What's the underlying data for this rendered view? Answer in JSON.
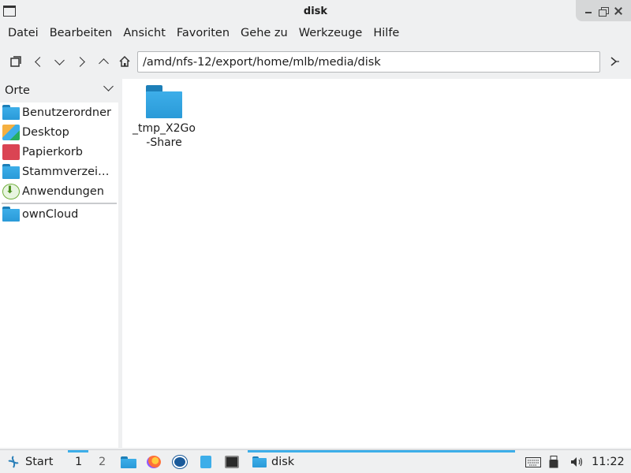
{
  "window": {
    "title": "disk"
  },
  "menubar": [
    "Datei",
    "Bearbeiten",
    "Ansicht",
    "Favoriten",
    "Gehe zu",
    "Werkzeuge",
    "Hilfe"
  ],
  "toolbar": {
    "path": "/amd/nfs-12/export/home/mlb/media/disk"
  },
  "sidepane": {
    "header": "Orte",
    "places": [
      {
        "label": "Benutzerordner",
        "icon": "home-folder-icon"
      },
      {
        "label": "Desktop",
        "icon": "desktop-icon"
      },
      {
        "label": "Papierkorb",
        "icon": "trash-icon"
      },
      {
        "label": "Stammverzei…",
        "icon": "root-folder-icon"
      },
      {
        "label": "Anwendungen",
        "icon": "applications-icon"
      }
    ],
    "bookmarks": [
      {
        "label": "ownCloud",
        "icon": "folder-icon"
      }
    ]
  },
  "files": [
    {
      "name_line1": "_tmp_X2Go",
      "name_line2": "-Share",
      "icon": "folder-icon"
    }
  ],
  "taskbar": {
    "start_label": "Start",
    "workspaces": [
      "1",
      "2"
    ],
    "task_label": "disk",
    "clock": "11:22"
  },
  "colors": {
    "accent": "#3daee9",
    "folder": "#2a9ad8",
    "trash": "#da4453"
  }
}
